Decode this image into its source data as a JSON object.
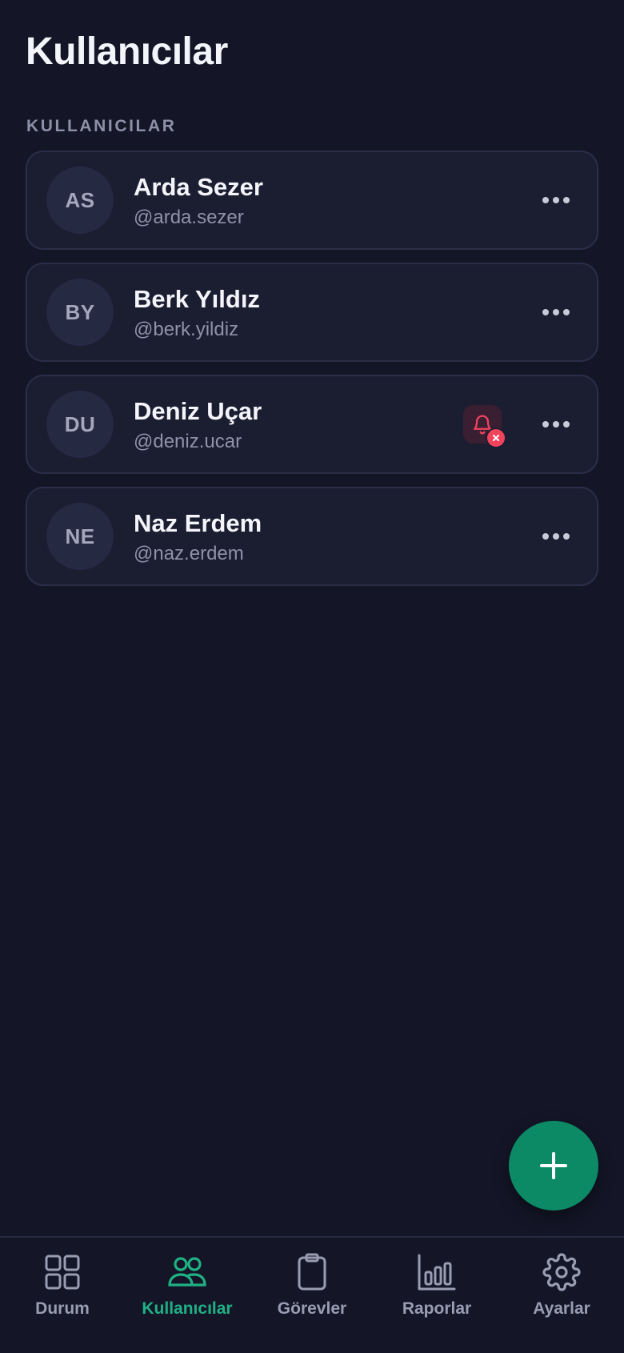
{
  "header": {
    "title": "Kullanıcılar"
  },
  "section": {
    "label": "KULLANICILAR"
  },
  "users": [
    {
      "initials": "AS",
      "name": "Arda Sezer",
      "handle": "@arda.sezer",
      "notifications_muted": false
    },
    {
      "initials": "BY",
      "name": "Berk Yıldız",
      "handle": "@berk.yildiz",
      "notifications_muted": false
    },
    {
      "initials": "DU",
      "name": "Deniz Uçar",
      "handle": "@deniz.ucar",
      "notifications_muted": true
    },
    {
      "initials": "NE",
      "name": "Naz Erdem",
      "handle": "@naz.erdem",
      "notifications_muted": false
    }
  ],
  "fab": {
    "icon": "plus-icon"
  },
  "nav": {
    "active": "Kullanıcılar",
    "items": [
      {
        "label": "Durum",
        "icon": "grid-icon"
      },
      {
        "label": "Kullanıcılar",
        "icon": "users-icon"
      },
      {
        "label": "Görevler",
        "icon": "clipboard-icon"
      },
      {
        "label": "Raporlar",
        "icon": "bar-chart-icon"
      },
      {
        "label": "Ayarlar",
        "icon": "gear-icon"
      }
    ]
  },
  "colors": {
    "background": "#141627",
    "card": "#1b1d31",
    "accent": "#1fb184",
    "fab": "#0c8a66",
    "danger": "#f0435c"
  }
}
